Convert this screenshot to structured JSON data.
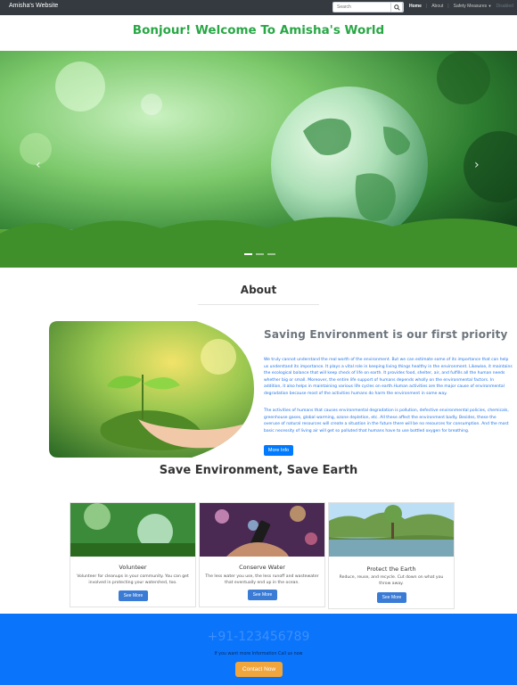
{
  "navbar": {
    "brand": "Amisha's Website",
    "search_placeholder": "Search",
    "links": [
      "Home",
      "About",
      "Safety Measures",
      "Disabled"
    ]
  },
  "title": "Bonjour! Welcome To Amisha's World",
  "about": {
    "heading": "About",
    "subheading": "Saving Environment is our first priority",
    "paragraph1": "We truly cannot understand the real worth of the environment. But we can estimate some of its importance that can help us understand its importance. It plays a vital role in keeping living things healthy in the environment. Likewise, it maintains the ecological balance that will keep check of life on earth. It provides food, shelter, air, and fulfills all the human needs whether big or small. Moreover, the entire life support of humans depends wholly on the environmental factors. In addition, it also helps in maintaining various life cycles on earth.Human activities are the major cause of environmental degradation because most of the activities humans do harm the environment in some way.",
    "paragraph2": "The activities of humans that causes environmental degradation is pollution, defective environmental policies, chemicals, greenhouse gases, global warming, ozone depletion, etc. All these affect the environment badly. Besides, these the overuse of natural resources will create a situation in the future there will be no resources for consumption. And the most basic necessity of living air will get so polluted that humans have to use bottled oxygen for breathing.",
    "button": "More Info"
  },
  "section2": {
    "heading": "Save Environment, Save Earth",
    "cards": [
      {
        "title": "Volunteer",
        "text": "Volunteer for cleanups in your community. You can get involved in protecting your watershed, too.",
        "button": "See More"
      },
      {
        "title": "Conserve Water",
        "text": "The less water you use, the less runoff and wastewater that eventually end up in the ocean.",
        "button": "See More"
      },
      {
        "title": "Protect the Earth",
        "text": "Reduce, reuse, and recycle. Cut down on what you throw away.",
        "button": "See More"
      }
    ]
  },
  "footer": {
    "phone": "+91-123456789",
    "text": "If you want more Information Call us now",
    "button": "Contact Now"
  },
  "colors": {
    "navbar": "#343a40",
    "title_green": "#28a745",
    "primary_blue": "#007bff",
    "footer_blue": "#0a74fb",
    "contact_orange": "#f0a63d"
  }
}
